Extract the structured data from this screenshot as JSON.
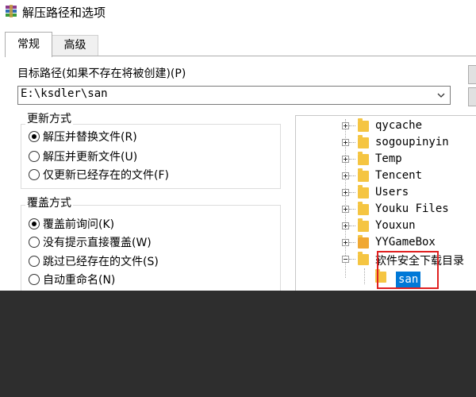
{
  "window": {
    "title": "解压路径和选项",
    "app_icon": "winrar-icon"
  },
  "tabs": [
    {
      "label": "常规",
      "active": true
    },
    {
      "label": "高级",
      "active": false
    }
  ],
  "path": {
    "label": "目标路径(如果不存在将被创建)(P)",
    "value": "E:\\ksdler\\san"
  },
  "update_mode": {
    "title": "更新方式",
    "options": [
      {
        "label": "解压并替换文件(R)",
        "checked": true
      },
      {
        "label": "解压并更新文件(U)",
        "checked": false
      },
      {
        "label": "仅更新已经存在的文件(F)",
        "checked": false
      }
    ]
  },
  "overwrite_mode": {
    "title": "覆盖方式",
    "options": [
      {
        "label": "覆盖前询问(K)",
        "checked": true
      },
      {
        "label": "没有提示直接覆盖(W)",
        "checked": false
      },
      {
        "label": "跳过已经存在的文件(S)",
        "checked": false
      },
      {
        "label": "自动重命名(N)",
        "checked": false
      }
    ]
  },
  "tree": {
    "items": [
      {
        "label": "qycache",
        "expander": "plus"
      },
      {
        "label": "sogoupinyin",
        "expander": "plus"
      },
      {
        "label": "Temp",
        "expander": "plus"
      },
      {
        "label": "Tencent",
        "expander": "plus"
      },
      {
        "label": "Users",
        "expander": "plus"
      },
      {
        "label": "Youku Files",
        "expander": "plus"
      },
      {
        "label": "Youxun",
        "expander": "plus"
      },
      {
        "label": "YYGameBox",
        "expander": "plus"
      },
      {
        "label": "软件安全下载目录",
        "expander": "minus"
      }
    ],
    "selected_child": "san"
  },
  "colors": {
    "selection": "#0078d7",
    "highlight_box": "#e02020",
    "overlay": "#2e2e2e"
  }
}
